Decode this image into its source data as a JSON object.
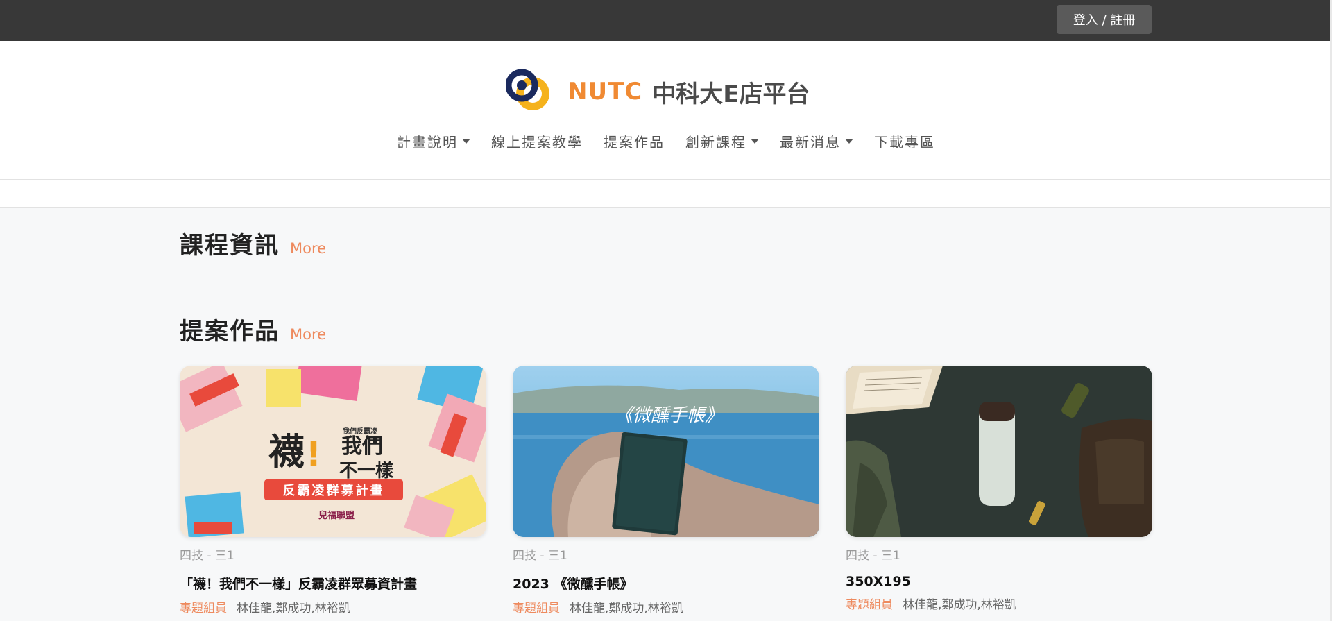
{
  "topbar": {
    "login_label": "登入 / 註冊"
  },
  "brand": {
    "en": "NUTC",
    "zh": "中科大E店平台",
    "colors": {
      "orange": "#f08a33",
      "navy": "#1b2a5e",
      "gold": "#f5b21c"
    }
  },
  "nav": {
    "items": [
      {
        "label": "計畫說明",
        "dropdown": true
      },
      {
        "label": "線上提案教學",
        "dropdown": false
      },
      {
        "label": "提案作品",
        "dropdown": false
      },
      {
        "label": "創新課程",
        "dropdown": true
      },
      {
        "label": "最新消息",
        "dropdown": true
      },
      {
        "label": "下載專區",
        "dropdown": false
      }
    ]
  },
  "sections": {
    "courses": {
      "title": "課程資訊",
      "more": "More"
    },
    "proposals": {
      "title": "提案作品",
      "more": "More"
    }
  },
  "cards": [
    {
      "category": "四技 - 三1",
      "title": "「襪！我們不一樣」反霸凌群眾募資計畫",
      "member_label": "專題組員",
      "members": "林佳龍,鄭成功,林裕凱",
      "image_text": {
        "top": "我們反霸凌",
        "big1": "襪",
        "big2": "我們",
        "big3": "不一樣",
        "band": "反霸凌群募計畫",
        "org": "兒福聯盟"
      }
    },
    {
      "category": "四技 - 三1",
      "title": "2023 《微醺手帳》",
      "member_label": "專題組員",
      "members": "林佳龍,鄭成功,林裕凱",
      "image_text": {
        "script": "《微醺手帳》"
      }
    },
    {
      "category": "四技 - 三1",
      "title": "350X195",
      "member_label": "專題組員",
      "members": "林佳龍,鄭成功,林裕凱"
    }
  ],
  "accent_color": "#ee8a5e"
}
